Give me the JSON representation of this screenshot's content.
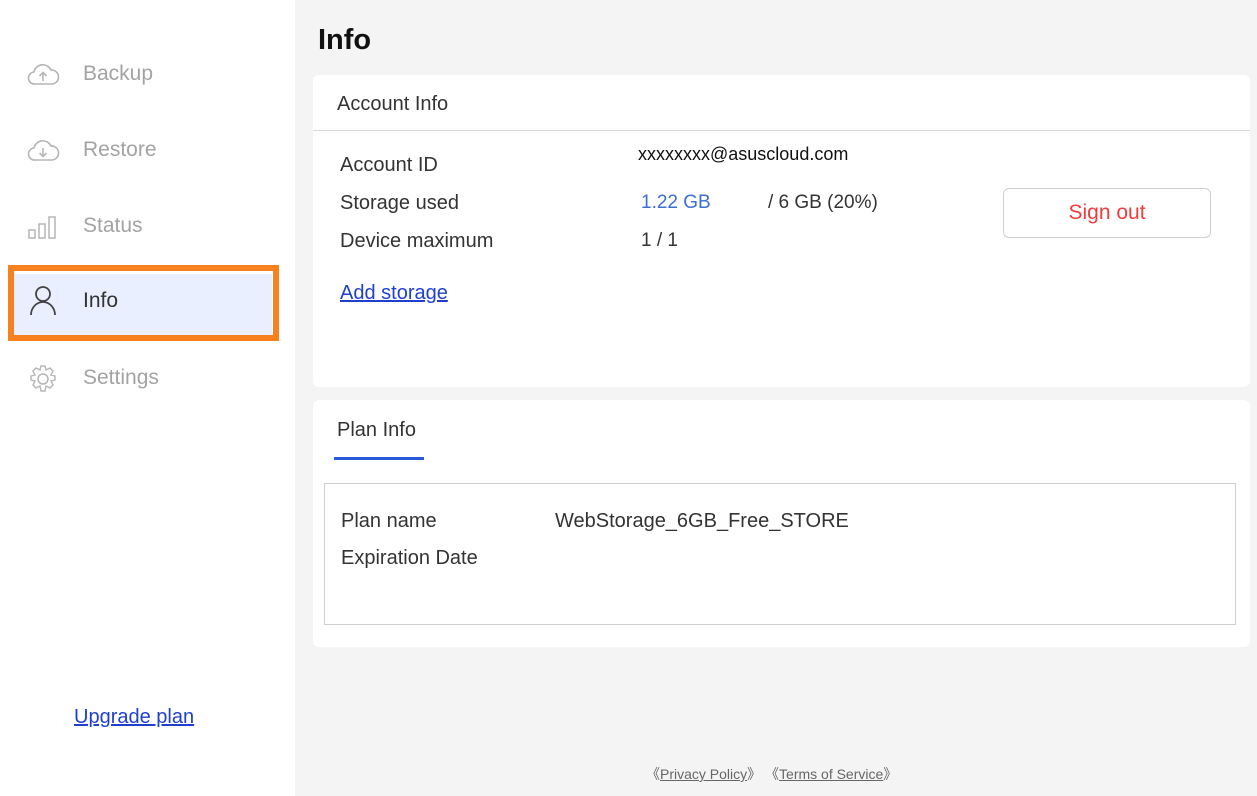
{
  "sidebar": {
    "items": [
      {
        "label": "Backup",
        "icon": "cloud-upload-icon"
      },
      {
        "label": "Restore",
        "icon": "cloud-download-icon"
      },
      {
        "label": "Status",
        "icon": "bar-chart-icon"
      },
      {
        "label": "Info",
        "icon": "user-icon",
        "active": true
      },
      {
        "label": "Settings",
        "icon": "gear-icon"
      }
    ],
    "upgrade_label": "Upgrade plan"
  },
  "main": {
    "title": "Info",
    "account": {
      "header": "Account Info",
      "account_id_label": "Account ID",
      "account_id_value": "xxxxxxxx@asuscloud.com",
      "storage_label": "Storage used",
      "storage_used": "1.22 GB",
      "storage_total": "/ 6 GB (20%)",
      "device_label": "Device maximum",
      "device_value": "1 / 1",
      "add_storage": "Add storage",
      "sign_out": "Sign out"
    },
    "plan": {
      "tab": "Plan Info",
      "plan_name_label": "Plan name",
      "plan_name_value": "WebStorage_6GB_Free_STORE",
      "expiration_label": "Expiration Date"
    }
  },
  "footer": {
    "privacy": "Privacy Policy",
    "terms": "Terms of Service",
    "open_bracket": "《",
    "close_bracket": "》"
  },
  "colors": {
    "accent": "#2a5bd7",
    "link": "#1f3fd1",
    "signout": "#f03c3c",
    "highlight": "#f7801f",
    "active_bg": "#e9efff"
  }
}
